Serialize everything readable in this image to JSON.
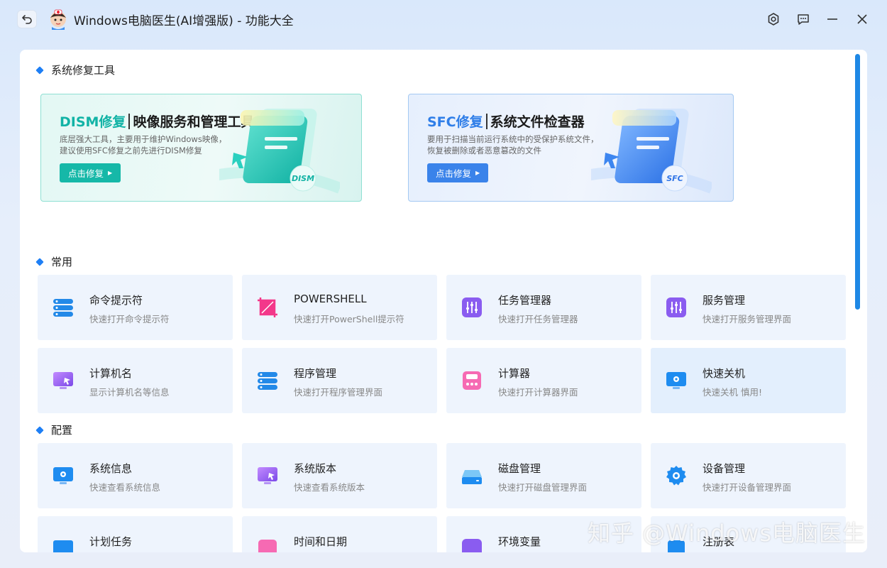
{
  "titlebar": {
    "title": "Windows电脑医生(AI增强版) - 功能大全",
    "back_icon": "back-icon",
    "settings_icon": "gear-icon",
    "feedback_icon": "chat-bubble-icon",
    "minimize_icon": "minimize-icon",
    "close_icon": "close-icon"
  },
  "sections": {
    "repair": "系统修复工具",
    "common": "常用",
    "config": "配置"
  },
  "banners": [
    {
      "accent": "DISM修复",
      "title": "映像服务和管理工具",
      "desc1": "底层强大工具，主要用于维护Windows映像，",
      "desc2": "建议使用SFC修复之前先进行DISM修复",
      "button": "点击修复",
      "badge": "DISM"
    },
    {
      "accent": "SFC修复",
      "title": "系统文件检查器",
      "desc1": "要用于扫描当前运行系统中的受保护系统文件，",
      "desc2": "恢复被删除或者恶意篡改的文件",
      "button": "点击修复",
      "badge": "SFC"
    }
  ],
  "common_cards": [
    {
      "title": "命令提示符",
      "sub": "快速打开命令提示符",
      "icon": "server-stack-icon"
    },
    {
      "title": "POWERSHELL",
      "sub": "快速打开PowerShell提示符",
      "icon": "crop-frame-icon"
    },
    {
      "title": "任务管理器",
      "sub": "快速打开任务管理器",
      "icon": "sliders-icon"
    },
    {
      "title": "服务管理",
      "sub": "快速打开服务管理界面",
      "icon": "sliders-icon"
    },
    {
      "title": "计算机名",
      "sub": "显示计算机名等信息",
      "icon": "monitor-cursor-icon"
    },
    {
      "title": "程序管理",
      "sub": "快速打开程序管理界面",
      "icon": "server-stack-icon"
    },
    {
      "title": "计算器",
      "sub": "快速打开计算器界面",
      "icon": "calculator-icon"
    },
    {
      "title": "快速关机",
      "sub": "快速关机 慎用!",
      "icon": "monitor-gear-icon"
    }
  ],
  "config_cards": [
    {
      "title": "系统信息",
      "sub": "快速查看系统信息",
      "icon": "monitor-gear-icon"
    },
    {
      "title": "系统版本",
      "sub": "快速查看系统版本",
      "icon": "monitor-cursor-icon"
    },
    {
      "title": "磁盘管理",
      "sub": "快速打开磁盘管理界面",
      "icon": "disk-drive-icon"
    },
    {
      "title": "设备管理",
      "sub": "快速打开设备管理界面",
      "icon": "gear-icon"
    },
    {
      "title": "计划任务",
      "sub": "",
      "icon": "calendar-icon"
    },
    {
      "title": "时间和日期",
      "sub": "",
      "icon": "clock-icon"
    },
    {
      "title": "环境变量",
      "sub": "",
      "icon": "variable-icon"
    },
    {
      "title": "注册表",
      "sub": "",
      "icon": "registry-icon"
    }
  ],
  "watermark": "知乎 @Windows电脑医生",
  "colors": {
    "accent_blue": "#1e7ff5",
    "teal": "#16b8a8",
    "card_bg": "#eef4fd"
  }
}
